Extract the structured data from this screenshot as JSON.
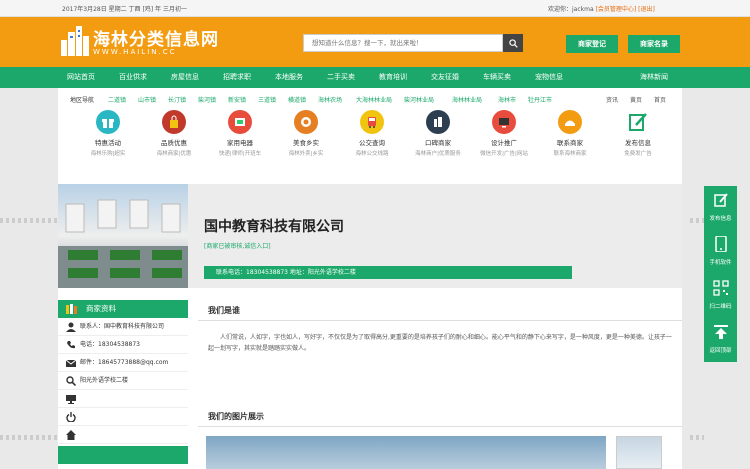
{
  "topbar": {
    "date": "2017年3月28日 星期二 丁酉 [鸡] 年 三月初一",
    "welcome": "欢迎你：jackma",
    "member_center": "[会员管理中心]",
    "logout": "[退出]"
  },
  "logo": {
    "cn": "海林分类信息网",
    "en": "WWW.HAILIN.CC"
  },
  "search": {
    "placeholder": "想知道什么信息？搜一下，就出来啦！"
  },
  "header_buttons": {
    "merchant_register": "商家登记",
    "merchant_list": "商家名录"
  },
  "nav": [
    "网站首页",
    "百业供求",
    "房屋信息",
    "招聘求职",
    "本地服务",
    "二手买卖",
    "教育培训",
    "交友征婚",
    "车辆买卖",
    "宠物信息",
    "海林新闻"
  ],
  "regions": {
    "label": "地区导航",
    "items": [
      "二道镇",
      "山市镇",
      "长汀镇",
      "柴河镇",
      "新安镇",
      "三道镇",
      "横道镇",
      "海林农场",
      "大海林林业局",
      "柴河林业局",
      "海林林业局",
      "海林市",
      "牡丹江市"
    ],
    "right": [
      "资讯",
      "黄页",
      "首页"
    ]
  },
  "services": [
    {
      "title": "特惠活动",
      "sub": "海林乐购|超实",
      "color": "#2ab7c4",
      "icon": "gift-icon"
    },
    {
      "title": "品质优惠",
      "sub": "海林商家|优惠",
      "color": "#c0392b",
      "icon": "shopping-bag-icon"
    },
    {
      "title": "家用电器",
      "sub": "快递|律师|开班车",
      "color": "#e74c3c",
      "icon": "appliance-icon"
    },
    {
      "title": "美食乡实",
      "sub": "海林外卖|乡实",
      "color": "#e67e22",
      "icon": "dish-icon"
    },
    {
      "title": "公交查询",
      "sub": "海林公交线路",
      "color": "#f1c40f",
      "icon": "bus-icon"
    },
    {
      "title": "口碑商家",
      "sub": "海林商户|优质服务",
      "color": "#2c3e50",
      "icon": "building-icon"
    },
    {
      "title": "设计推广",
      "sub": "微信开发|广告|网站",
      "color": "#e74c3c",
      "icon": "monitor-icon"
    },
    {
      "title": "联系商家",
      "sub": "联系海林商家",
      "color": "#f39c12",
      "icon": "contact-icon"
    },
    {
      "title": "发布信息",
      "sub": "免费发广告",
      "color": "#ffffff",
      "icon": "edit-icon"
    }
  ],
  "company": {
    "name": "国中教育科技有限公司",
    "verify": "[商家已被审核,诚信入口]",
    "contact_bar": "联系电话：18304538873    地址：阳光外语学校二楼"
  },
  "sidebar": {
    "title": "商家资料",
    "rows": [
      {
        "icon": "person-icon",
        "text": "联系人：国中教育科技有限公司"
      },
      {
        "icon": "phone-icon",
        "text": "电话：18304538873"
      },
      {
        "icon": "mail-icon",
        "text": "邮件：18645773888@qq.com"
      },
      {
        "icon": "search-icon",
        "text": "阳光外语学校二楼"
      },
      {
        "icon": "monitor-icon",
        "text": ""
      },
      {
        "icon": "power-icon",
        "text": ""
      },
      {
        "icon": "home-icon",
        "text": ""
      }
    ]
  },
  "about": {
    "title": "我们是谁",
    "text": "人们常说，人如字，字也如人，写好字，不仅仅是为了取得高分,更重要的是培养孩子们的耐心和细心。能心平气和的静下心来写字，是一种风度，更是一种美德。让孩子一起一划写字，其实就是踏踏实实做人。"
  },
  "gallery": {
    "title": "我们的图片展示"
  },
  "float_bar": [
    {
      "label": "发布信息",
      "icon": "edit-icon"
    },
    {
      "label": "手机软件",
      "icon": "mobile-icon"
    },
    {
      "label": "扫二维码",
      "icon": "qrcode-icon"
    },
    {
      "label": "返回顶部",
      "icon": "arrow-up-icon"
    }
  ]
}
